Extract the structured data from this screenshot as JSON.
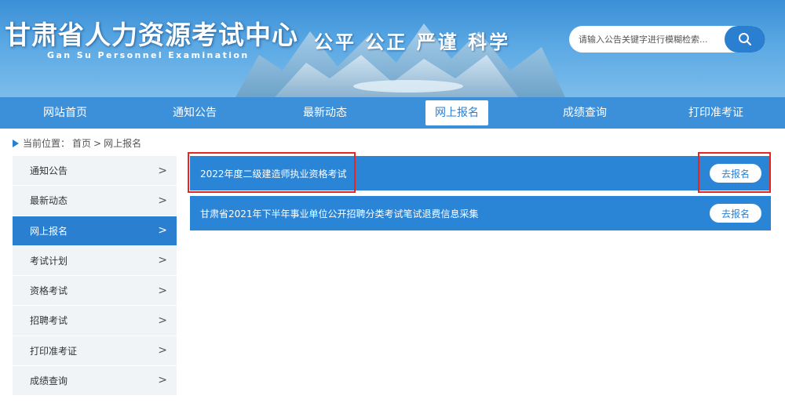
{
  "header": {
    "title": "甘肃省人力资源考试中心",
    "subtitle": "Gan Su Personnel Examination",
    "slogan": "公平 公正 严谨 科学",
    "search_placeholder": "请输入公告关键字进行模糊检索...",
    "search_icon": "search-icon"
  },
  "nav": {
    "items": [
      {
        "label": "网站首页",
        "active": false
      },
      {
        "label": "通知公告",
        "active": false
      },
      {
        "label": "最新动态",
        "active": false
      },
      {
        "label": "网上报名",
        "active": true
      },
      {
        "label": "成绩查询",
        "active": false
      },
      {
        "label": "打印准考证",
        "active": false
      }
    ]
  },
  "breadcrumb": {
    "prefix": "当前位置：",
    "home": "首页",
    "separator": ">",
    "current": "网上报名"
  },
  "sidebar": {
    "items": [
      {
        "label": "通知公告",
        "active": false
      },
      {
        "label": "最新动态",
        "active": false
      },
      {
        "label": "网上报名",
        "active": true
      },
      {
        "label": "考试计划",
        "active": false
      },
      {
        "label": "资格考试",
        "active": false
      },
      {
        "label": "招聘考试",
        "active": false
      },
      {
        "label": "打印准考证",
        "active": false
      },
      {
        "label": "成绩查询",
        "active": false
      }
    ],
    "chevron": ">"
  },
  "exams": [
    {
      "title": "2022年度二级建造师执业资格考试",
      "button": "去报名"
    },
    {
      "title": "甘肃省2021年下半年事业单位公开招聘分类考试笔试退费信息采集",
      "button": "去报名"
    }
  ],
  "colors": {
    "primary": "#2b7fd1",
    "nav_bg": "#3c8fd9",
    "highlight": "#e8261f"
  }
}
